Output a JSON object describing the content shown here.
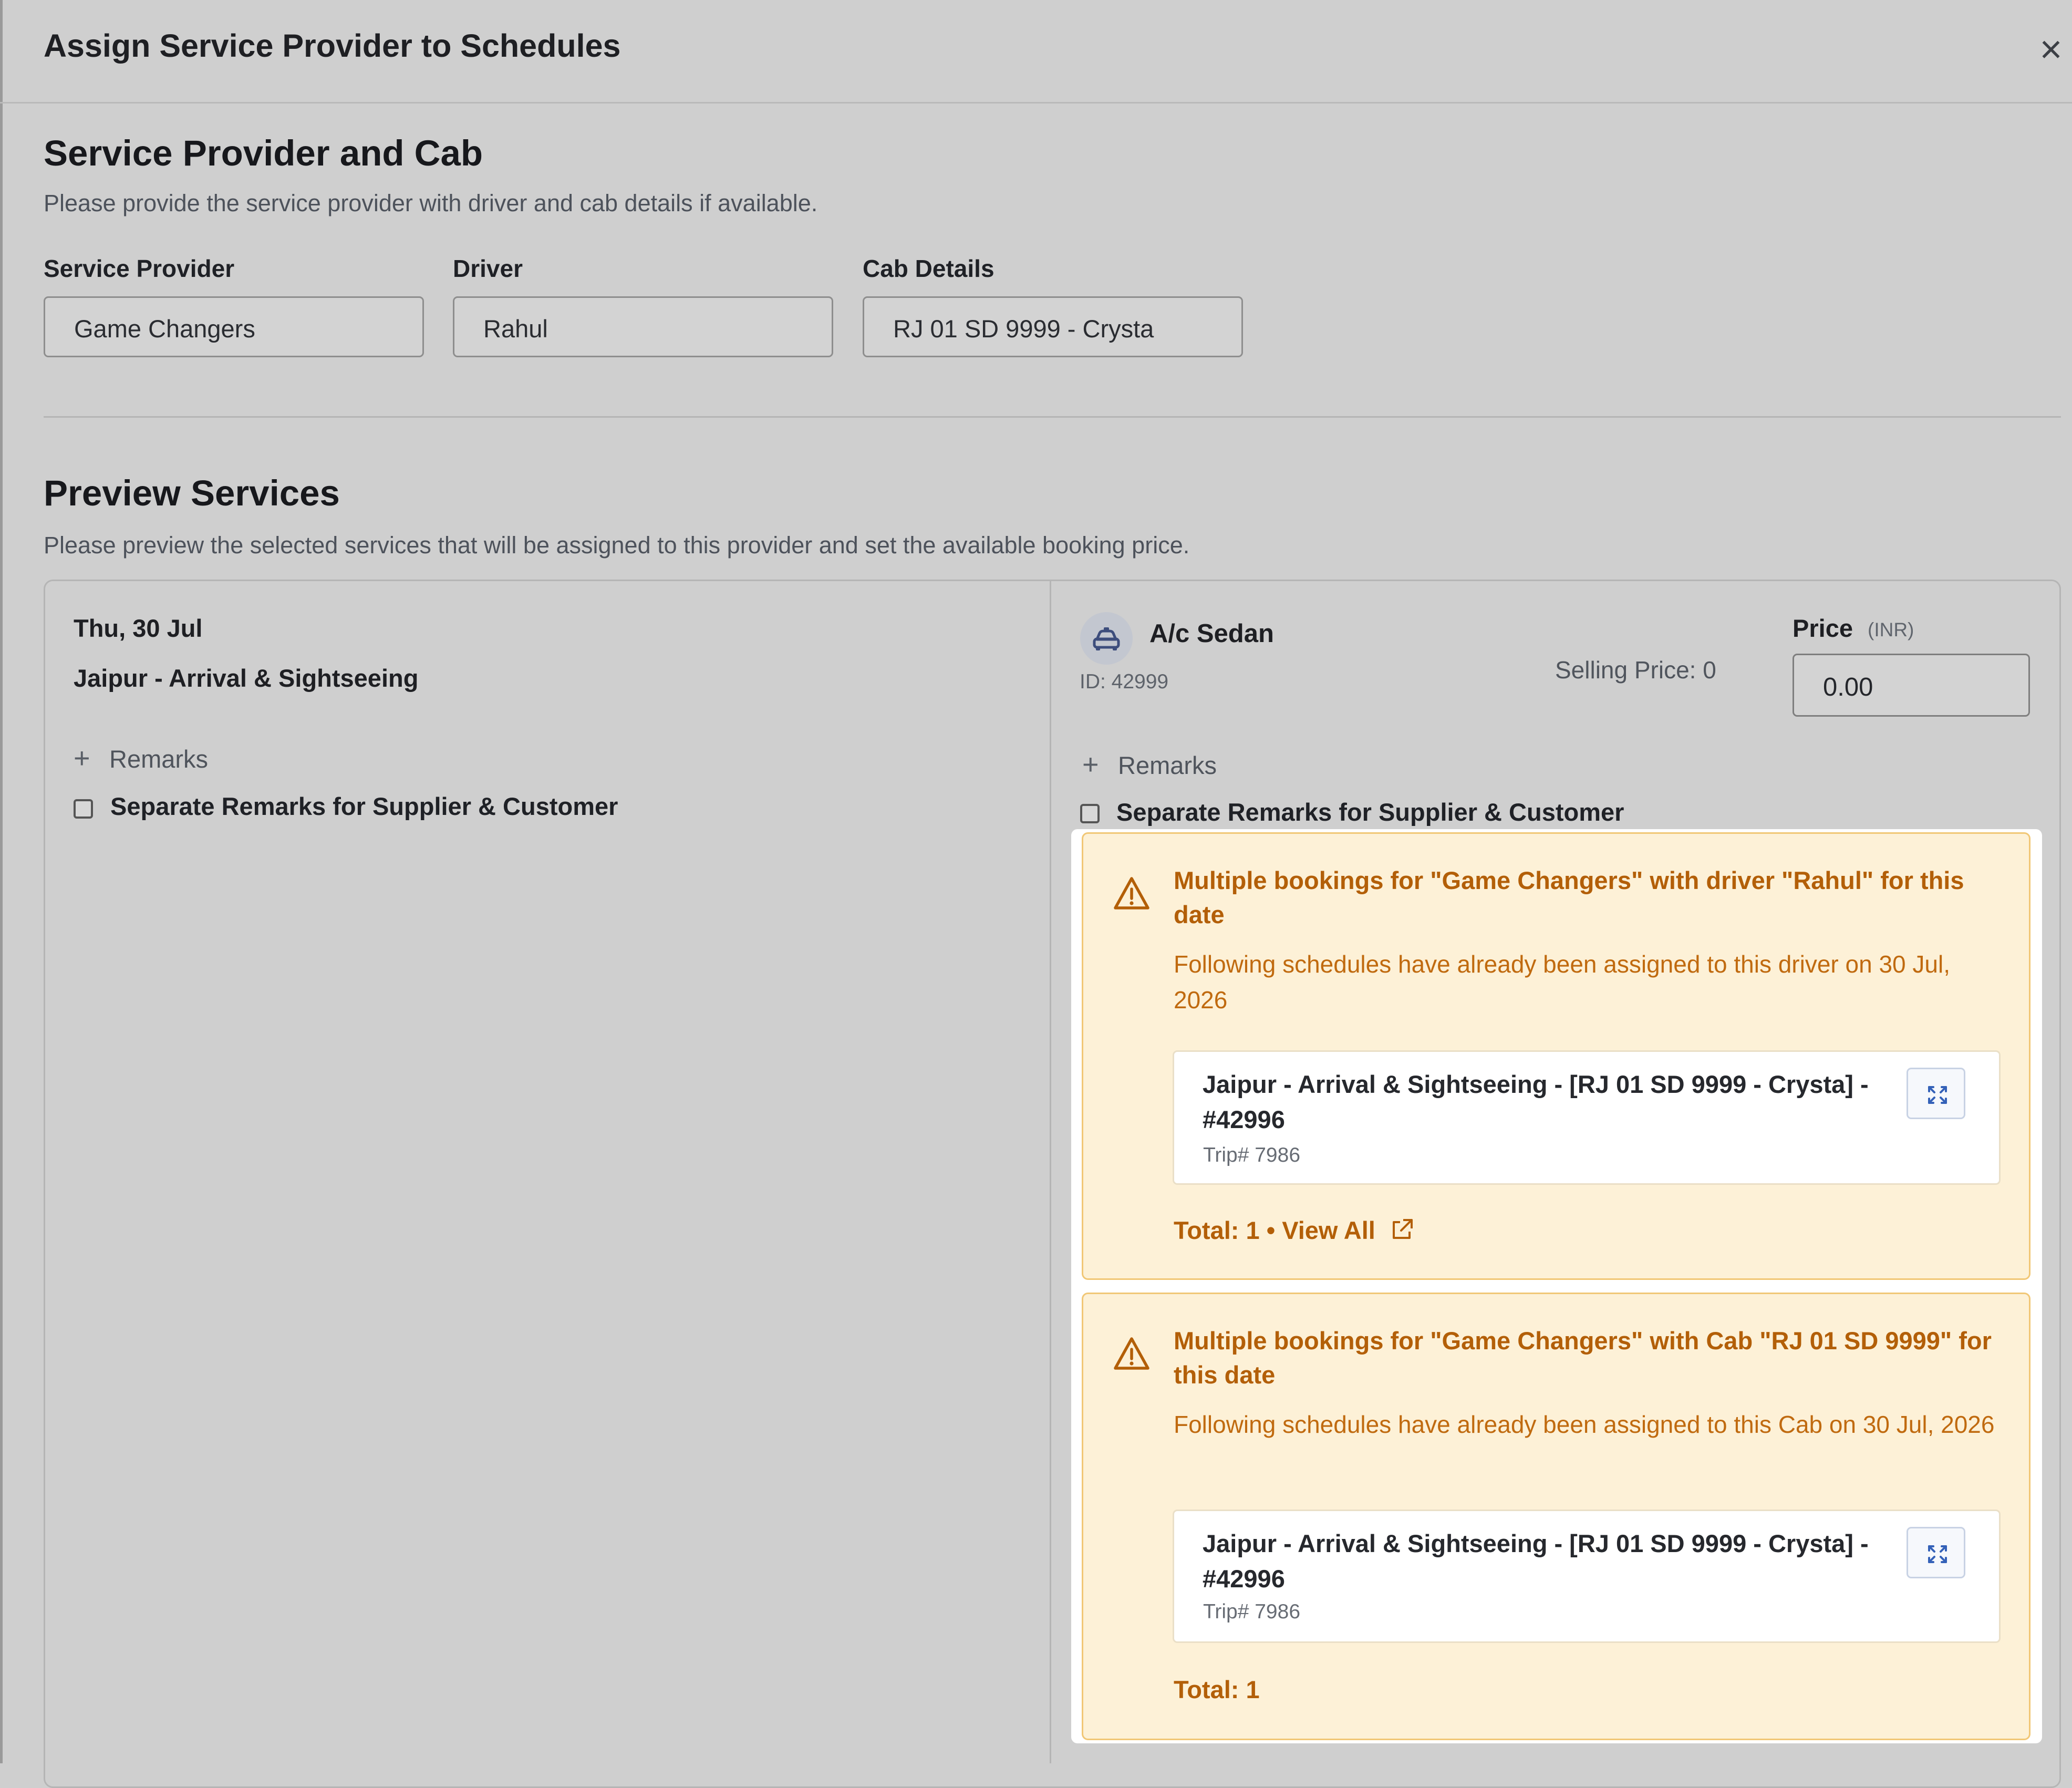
{
  "dialog": {
    "title": "Assign Service Provider to Schedules",
    "close_icon": "close-icon"
  },
  "provider_section": {
    "title": "Service Provider and Cab",
    "subtitle": "Please provide the service provider with driver and cab details if available.",
    "fields": [
      {
        "label": "Service Provider",
        "value": "Game Changers"
      },
      {
        "label": "Driver",
        "value": "Rahul"
      },
      {
        "label": "Cab Details",
        "value": "RJ 01 SD 9999 - Crysta"
      }
    ]
  },
  "preview_section": {
    "title": "Preview Services",
    "subtitle": "Please preview the selected services that will be assigned to this provider and set the available booking price."
  },
  "service": {
    "date": "Thu, 30 Jul",
    "route": "Jaipur - Arrival & Sightseeing",
    "remarks_label": "Remarks",
    "separate_remarks_label": "Separate Remarks for Supplier & Customer",
    "separate_remarks_checked": false,
    "cab": {
      "icon": "cab-icon",
      "name": "A/c Sedan",
      "id_text": "ID: 42999",
      "selling_price": "Selling Price: 0",
      "price_label": "Price",
      "price_unit": "(INR)",
      "price_value": "0.00"
    },
    "cab_remarks_label": "Remarks",
    "cab_separate_remarks_label": "Separate Remarks for Supplier & Customer"
  },
  "warnings": [
    {
      "icon": "warning-triangle-icon",
      "title": "Multiple bookings for \"Game Changers\" with driver \"Rahul\" for this date",
      "description": "Following schedules have already been assigned to this driver on 30 Jul, 2026",
      "schedule_title": "Jaipur - Arrival & Sightseeing - [RJ 01 SD 9999 - Crysta] - #42996",
      "trip": "Trip# 7986",
      "expand_icon": "expand-icon",
      "total": "Total: 1",
      "separator": " • ",
      "view_all": "View All",
      "external_link_icon": "external-link-icon"
    },
    {
      "icon": "warning-triangle-icon",
      "title": "Multiple bookings for \"Game Changers\" with Cab \"RJ 01 SD 9999\" for this date",
      "description": "Following schedules have already been assigned to this Cab on 30 Jul, 2026",
      "schedule_title": "Jaipur - Arrival & Sightseeing - [RJ 01 SD 9999 - Crysta] - #42996",
      "trip": "Trip# 7986",
      "expand_icon": "expand-icon",
      "total": "Total: 1"
    }
  ],
  "colors": {
    "overlay_background": "#cfcfcf",
    "warning_text": "#b35f08",
    "warning_background": "#fdf1d7"
  }
}
